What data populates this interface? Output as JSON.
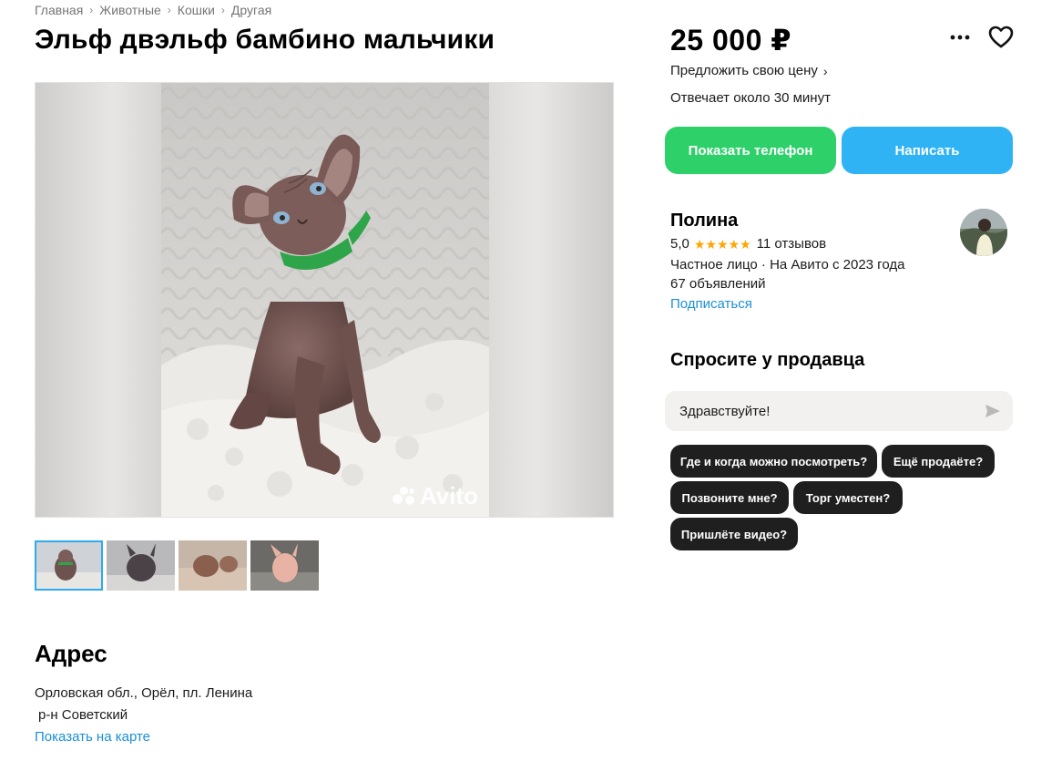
{
  "breadcrumbs": [
    "Главная",
    "Животные",
    "Кошки",
    "Другая"
  ],
  "title": "Эльф двэльф бамбино мальчики",
  "gallery": {
    "watermark": "Avito",
    "thumbnail_count": 4
  },
  "address": {
    "heading": "Адрес",
    "line1": "Орловская обл., Орёл, пл. Ленина",
    "line2": "р-н Советский",
    "map_link": "Показать на карте"
  },
  "offer": {
    "price": "25 000 ₽",
    "offer_price_link": "Предложить свою цену",
    "reply_time": "Отвечает около 30 минут",
    "show_phone_label": "Показать телефон",
    "write_label": "Написать"
  },
  "seller": {
    "name": "Полина",
    "rating": "5,0",
    "stars": 5,
    "reviews": "11 отзывов",
    "type_since": "Частное лицо · На Авито с 2023 года",
    "listings": "67 объявлений",
    "subscribe_label": "Подписаться"
  },
  "ask": {
    "heading": "Спросите у продавца",
    "message_value": "Здравствуйте!",
    "quick_questions": [
      "Где и когда можно посмотреть?",
      "Ещё продаёте?",
      "Позвоните мне?",
      "Торг уместен?",
      "Пришлёте видео?"
    ]
  },
  "icons": {
    "more": "more-horizontal-icon",
    "favorite": "heart-icon",
    "send": "send-icon",
    "chevron": "chevron-right-icon"
  },
  "colors": {
    "green_button": "#2ed06a",
    "blue_button": "#2fb3f5",
    "link": "#1a8fd6",
    "chip_bg": "#1f1f1f",
    "star": "#ffa500"
  }
}
